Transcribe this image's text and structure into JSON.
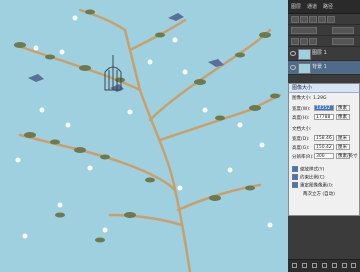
{
  "panel": {
    "tabs": [
      "图层",
      "通道",
      "路径"
    ],
    "layers": [
      {
        "name": "图层 1",
        "active": false
      },
      {
        "name": "背景 1",
        "active": true
      }
    ]
  },
  "dialog": {
    "title": "图像大小",
    "size_line": "图像大小: 1.29G",
    "width_label": "宽度(W):",
    "width_value": "14252",
    "width_unit": "像素",
    "height_label": "高度(H):",
    "height_value": "17788",
    "height_unit": "像素",
    "doc_size_label": "文档大小:",
    "doc_width_label": "宽度(D):",
    "doc_width_value": "158.46",
    "doc_width_unit": "厘米",
    "doc_height_label": "高度(G):",
    "doc_height_value": "150.42",
    "doc_height_unit": "厘米",
    "res_label": "分辨率(R):",
    "res_value": "300",
    "res_unit": "像素/英寸",
    "opt1": "缩放样式(Y)",
    "opt2": "约束比例(C)",
    "opt3": "重定图像像素(I):",
    "resample_method": "两次立方 (自动)"
  },
  "colors": {
    "canvas_bg": "#9fd0df",
    "branch": "#c8a06c",
    "leaf": "#6e7a4e",
    "flower": "#ffffff",
    "bird": "#5a6f9a"
  }
}
